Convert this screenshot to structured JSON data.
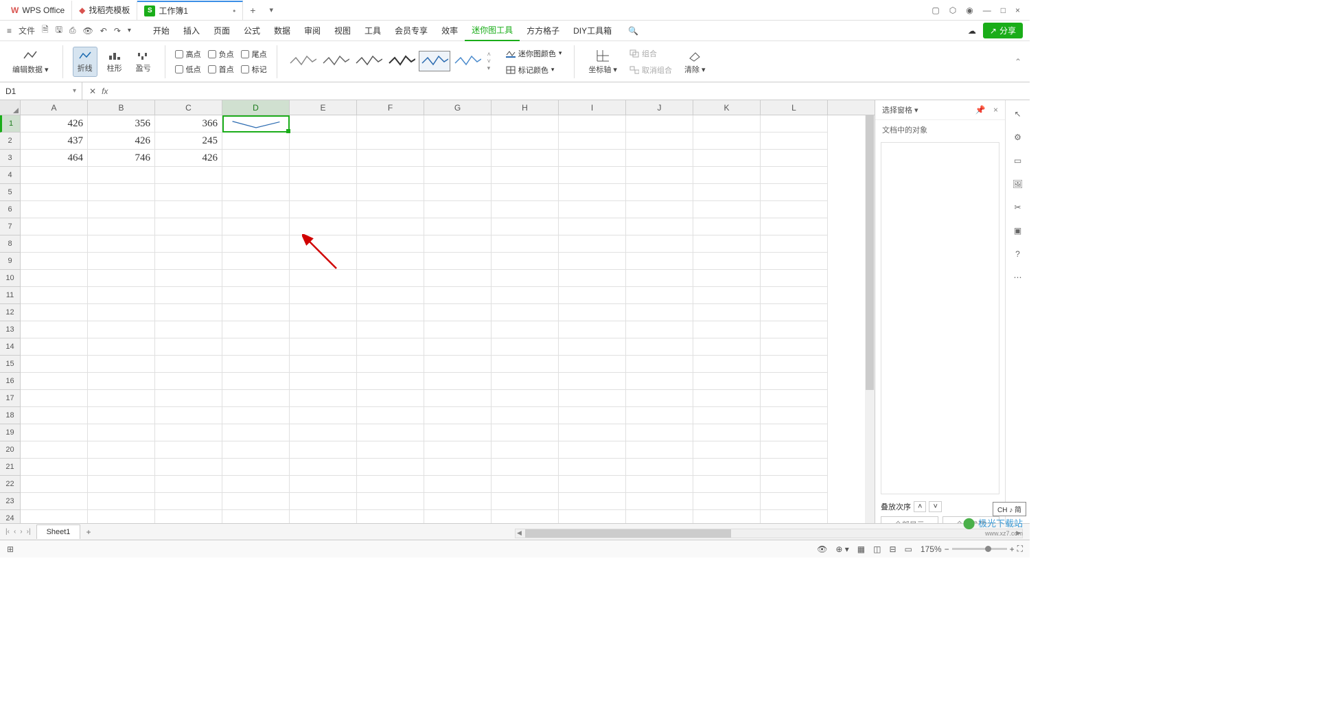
{
  "title_tabs": [
    {
      "icon": "W",
      "label": "WPS Office"
    },
    {
      "icon": "D",
      "label": "找稻壳模板"
    },
    {
      "icon": "S",
      "label": "工作簿1",
      "active": true,
      "modified": true
    }
  ],
  "menu": {
    "file": "文件",
    "tabs": [
      "开始",
      "插入",
      "页面",
      "公式",
      "数据",
      "审阅",
      "视图",
      "工具",
      "会员专享",
      "效率",
      "迷你图工具",
      "方方格子",
      "DIY工具箱"
    ],
    "active_tab": "迷你图工具",
    "share": "分享"
  },
  "ribbon": {
    "edit_data": "编辑数据",
    "chart_types": [
      "折线",
      "柱形",
      "盈亏"
    ],
    "checkboxes": {
      "hi": "高点",
      "lo": "低点",
      "neg": "负点",
      "first": "首点",
      "last": "尾点",
      "mark": "标记"
    },
    "spark_color": "迷你图颜色",
    "marker_color": "标记颜色",
    "axis": "坐标轴",
    "group": "组合",
    "ungroup": "取消组合",
    "clear": "清除"
  },
  "formula_bar": {
    "cell_ref": "D1",
    "fx": "fx"
  },
  "columns": [
    "A",
    "B",
    "C",
    "D",
    "E",
    "F",
    "G",
    "H",
    "I",
    "J",
    "K",
    "L"
  ],
  "selected_col": "D",
  "selected_row": 1,
  "row_count": 24,
  "data": {
    "r1": {
      "A": "426",
      "B": "356",
      "C": "366"
    },
    "r2": {
      "A": "437",
      "B": "426",
      "C": "245"
    },
    "r3": {
      "A": "464",
      "B": "746",
      "C": "426"
    }
  },
  "side_panel": {
    "title": "选择窗格",
    "subtitle": "文档中的对象",
    "stack": "叠放次序",
    "show_all": "全部显示",
    "hide_all": "全部隐藏"
  },
  "sheet_tabs": {
    "active": "Sheet1"
  },
  "status": {
    "zoom": "175%"
  },
  "ime": "CH ♪ 简",
  "watermark": {
    "brand": "极光下载站",
    "site": "www.xz7.com"
  }
}
